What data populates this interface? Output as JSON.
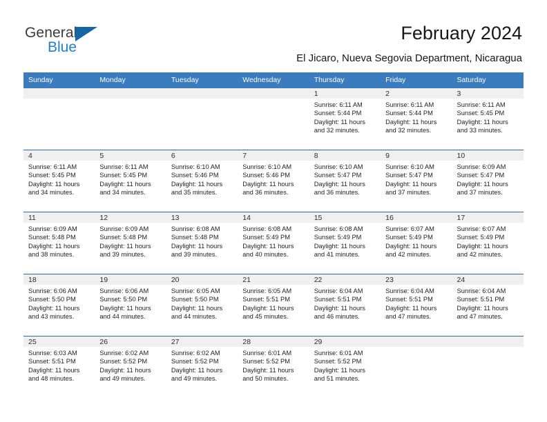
{
  "brand": {
    "line1": "General",
    "line2": "Blue",
    "logo_icon": "triangle-logo-icon",
    "accent_color": "#1f7fd0"
  },
  "header": {
    "title": "February 2024",
    "subtitle": "El Jicaro, Nueva Segovia Department, Nicaragua"
  },
  "theme": {
    "header_bg": "#3a7cbe",
    "row_separator": "#2f6aa8",
    "daynum_band": "#f0f0f0"
  },
  "calendar": {
    "weekday_headers": [
      "Sunday",
      "Monday",
      "Tuesday",
      "Wednesday",
      "Thursday",
      "Friday",
      "Saturday"
    ],
    "weeks": [
      [
        {
          "day": "",
          "sunrise": "",
          "sunset": "",
          "daylight": "",
          "daylight2": ""
        },
        {
          "day": "",
          "sunrise": "",
          "sunset": "",
          "daylight": "",
          "daylight2": ""
        },
        {
          "day": "",
          "sunrise": "",
          "sunset": "",
          "daylight": "",
          "daylight2": ""
        },
        {
          "day": "",
          "sunrise": "",
          "sunset": "",
          "daylight": "",
          "daylight2": ""
        },
        {
          "day": "1",
          "sunrise": "Sunrise: 6:11 AM",
          "sunset": "Sunset: 5:44 PM",
          "daylight": "Daylight: 11 hours",
          "daylight2": "and 32 minutes."
        },
        {
          "day": "2",
          "sunrise": "Sunrise: 6:11 AM",
          "sunset": "Sunset: 5:44 PM",
          "daylight": "Daylight: 11 hours",
          "daylight2": "and 32 minutes."
        },
        {
          "day": "3",
          "sunrise": "Sunrise: 6:11 AM",
          "sunset": "Sunset: 5:45 PM",
          "daylight": "Daylight: 11 hours",
          "daylight2": "and 33 minutes."
        }
      ],
      [
        {
          "day": "4",
          "sunrise": "Sunrise: 6:11 AM",
          "sunset": "Sunset: 5:45 PM",
          "daylight": "Daylight: 11 hours",
          "daylight2": "and 34 minutes."
        },
        {
          "day": "5",
          "sunrise": "Sunrise: 6:11 AM",
          "sunset": "Sunset: 5:45 PM",
          "daylight": "Daylight: 11 hours",
          "daylight2": "and 34 minutes."
        },
        {
          "day": "6",
          "sunrise": "Sunrise: 6:10 AM",
          "sunset": "Sunset: 5:46 PM",
          "daylight": "Daylight: 11 hours",
          "daylight2": "and 35 minutes."
        },
        {
          "day": "7",
          "sunrise": "Sunrise: 6:10 AM",
          "sunset": "Sunset: 5:46 PM",
          "daylight": "Daylight: 11 hours",
          "daylight2": "and 36 minutes."
        },
        {
          "day": "8",
          "sunrise": "Sunrise: 6:10 AM",
          "sunset": "Sunset: 5:47 PM",
          "daylight": "Daylight: 11 hours",
          "daylight2": "and 36 minutes."
        },
        {
          "day": "9",
          "sunrise": "Sunrise: 6:10 AM",
          "sunset": "Sunset: 5:47 PM",
          "daylight": "Daylight: 11 hours",
          "daylight2": "and 37 minutes."
        },
        {
          "day": "10",
          "sunrise": "Sunrise: 6:09 AM",
          "sunset": "Sunset: 5:47 PM",
          "daylight": "Daylight: 11 hours",
          "daylight2": "and 37 minutes."
        }
      ],
      [
        {
          "day": "11",
          "sunrise": "Sunrise: 6:09 AM",
          "sunset": "Sunset: 5:48 PM",
          "daylight": "Daylight: 11 hours",
          "daylight2": "and 38 minutes."
        },
        {
          "day": "12",
          "sunrise": "Sunrise: 6:09 AM",
          "sunset": "Sunset: 5:48 PM",
          "daylight": "Daylight: 11 hours",
          "daylight2": "and 39 minutes."
        },
        {
          "day": "13",
          "sunrise": "Sunrise: 6:08 AM",
          "sunset": "Sunset: 5:48 PM",
          "daylight": "Daylight: 11 hours",
          "daylight2": "and 39 minutes."
        },
        {
          "day": "14",
          "sunrise": "Sunrise: 6:08 AM",
          "sunset": "Sunset: 5:49 PM",
          "daylight": "Daylight: 11 hours",
          "daylight2": "and 40 minutes."
        },
        {
          "day": "15",
          "sunrise": "Sunrise: 6:08 AM",
          "sunset": "Sunset: 5:49 PM",
          "daylight": "Daylight: 11 hours",
          "daylight2": "and 41 minutes."
        },
        {
          "day": "16",
          "sunrise": "Sunrise: 6:07 AM",
          "sunset": "Sunset: 5:49 PM",
          "daylight": "Daylight: 11 hours",
          "daylight2": "and 42 minutes."
        },
        {
          "day": "17",
          "sunrise": "Sunrise: 6:07 AM",
          "sunset": "Sunset: 5:49 PM",
          "daylight": "Daylight: 11 hours",
          "daylight2": "and 42 minutes."
        }
      ],
      [
        {
          "day": "18",
          "sunrise": "Sunrise: 6:06 AM",
          "sunset": "Sunset: 5:50 PM",
          "daylight": "Daylight: 11 hours",
          "daylight2": "and 43 minutes."
        },
        {
          "day": "19",
          "sunrise": "Sunrise: 6:06 AM",
          "sunset": "Sunset: 5:50 PM",
          "daylight": "Daylight: 11 hours",
          "daylight2": "and 44 minutes."
        },
        {
          "day": "20",
          "sunrise": "Sunrise: 6:05 AM",
          "sunset": "Sunset: 5:50 PM",
          "daylight": "Daylight: 11 hours",
          "daylight2": "and 44 minutes."
        },
        {
          "day": "21",
          "sunrise": "Sunrise: 6:05 AM",
          "sunset": "Sunset: 5:51 PM",
          "daylight": "Daylight: 11 hours",
          "daylight2": "and 45 minutes."
        },
        {
          "day": "22",
          "sunrise": "Sunrise: 6:04 AM",
          "sunset": "Sunset: 5:51 PM",
          "daylight": "Daylight: 11 hours",
          "daylight2": "and 46 minutes."
        },
        {
          "day": "23",
          "sunrise": "Sunrise: 6:04 AM",
          "sunset": "Sunset: 5:51 PM",
          "daylight": "Daylight: 11 hours",
          "daylight2": "and 47 minutes."
        },
        {
          "day": "24",
          "sunrise": "Sunrise: 6:04 AM",
          "sunset": "Sunset: 5:51 PM",
          "daylight": "Daylight: 11 hours",
          "daylight2": "and 47 minutes."
        }
      ],
      [
        {
          "day": "25",
          "sunrise": "Sunrise: 6:03 AM",
          "sunset": "Sunset: 5:51 PM",
          "daylight": "Daylight: 11 hours",
          "daylight2": "and 48 minutes."
        },
        {
          "day": "26",
          "sunrise": "Sunrise: 6:02 AM",
          "sunset": "Sunset: 5:52 PM",
          "daylight": "Daylight: 11 hours",
          "daylight2": "and 49 minutes."
        },
        {
          "day": "27",
          "sunrise": "Sunrise: 6:02 AM",
          "sunset": "Sunset: 5:52 PM",
          "daylight": "Daylight: 11 hours",
          "daylight2": "and 49 minutes."
        },
        {
          "day": "28",
          "sunrise": "Sunrise: 6:01 AM",
          "sunset": "Sunset: 5:52 PM",
          "daylight": "Daylight: 11 hours",
          "daylight2": "and 50 minutes."
        },
        {
          "day": "29",
          "sunrise": "Sunrise: 6:01 AM",
          "sunset": "Sunset: 5:52 PM",
          "daylight": "Daylight: 11 hours",
          "daylight2": "and 51 minutes."
        },
        {
          "day": "",
          "sunrise": "",
          "sunset": "",
          "daylight": "",
          "daylight2": ""
        },
        {
          "day": "",
          "sunrise": "",
          "sunset": "",
          "daylight": "",
          "daylight2": ""
        }
      ]
    ]
  }
}
